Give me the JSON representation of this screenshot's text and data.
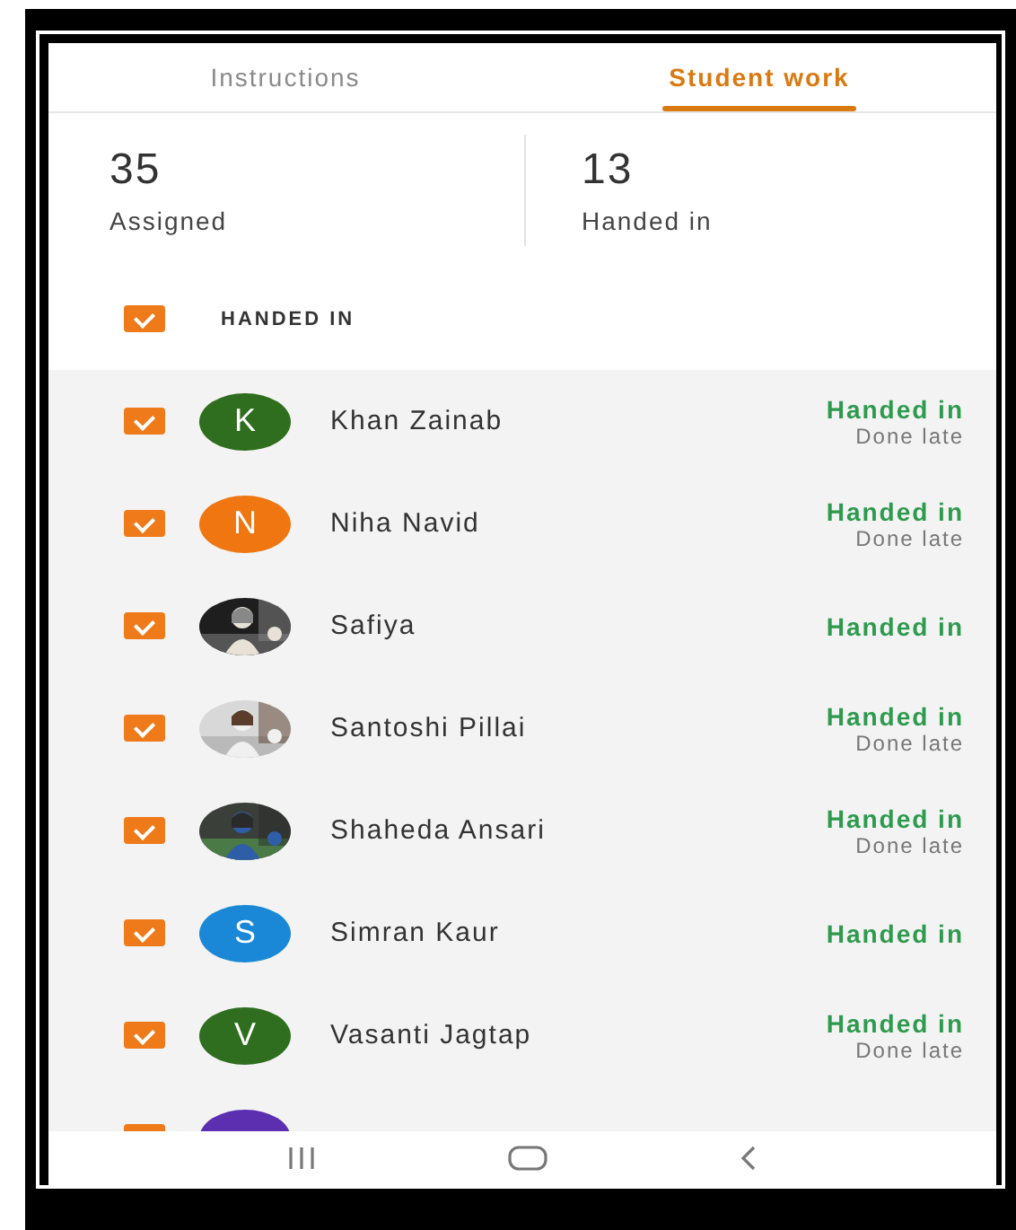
{
  "tabs": [
    {
      "label": "Instructions",
      "selected": false
    },
    {
      "label": "Student work",
      "selected": true
    }
  ],
  "stats": [
    {
      "value": "35",
      "label": "Assigned"
    },
    {
      "value": "13",
      "label": "Handed in"
    }
  ],
  "filter": {
    "label": "HANDED IN",
    "checked": true
  },
  "students": [
    {
      "name": "Khan Zainab",
      "avatar": {
        "kind": "letter",
        "letter": "K",
        "color": "#2f6e1e"
      },
      "checked": true,
      "status": "Handed in",
      "note": "Done late"
    },
    {
      "name": "Niha Navid",
      "avatar": {
        "kind": "letter",
        "letter": "N",
        "color": "#ef7610"
      },
      "checked": true,
      "status": "Handed in",
      "note": "Done late"
    },
    {
      "name": "Safiya",
      "checked": true,
      "status": "Handed in"
    },
    {
      "name": "Santoshi Pillai",
      "checked": true,
      "status": "Handed in",
      "note": "Done late"
    },
    {
      "name": "Shaheda Ansari",
      "checked": true,
      "status": "Handed in",
      "note": "Done late"
    },
    {
      "name": "Simran Kaur",
      "avatar": {
        "kind": "letter",
        "letter": "S",
        "color": "#1a88d6"
      },
      "checked": true,
      "status": "Handed in"
    },
    {
      "name": "Vasanti Jagtap",
      "avatar": {
        "kind": "letter",
        "letter": "V",
        "color": "#2f6e1e"
      },
      "checked": true,
      "status": "Handed in",
      "note": "Done late"
    },
    {
      "avatar": {
        "kind": "letter",
        "color": "#5b2fb0"
      },
      "checked": true
    }
  ]
}
